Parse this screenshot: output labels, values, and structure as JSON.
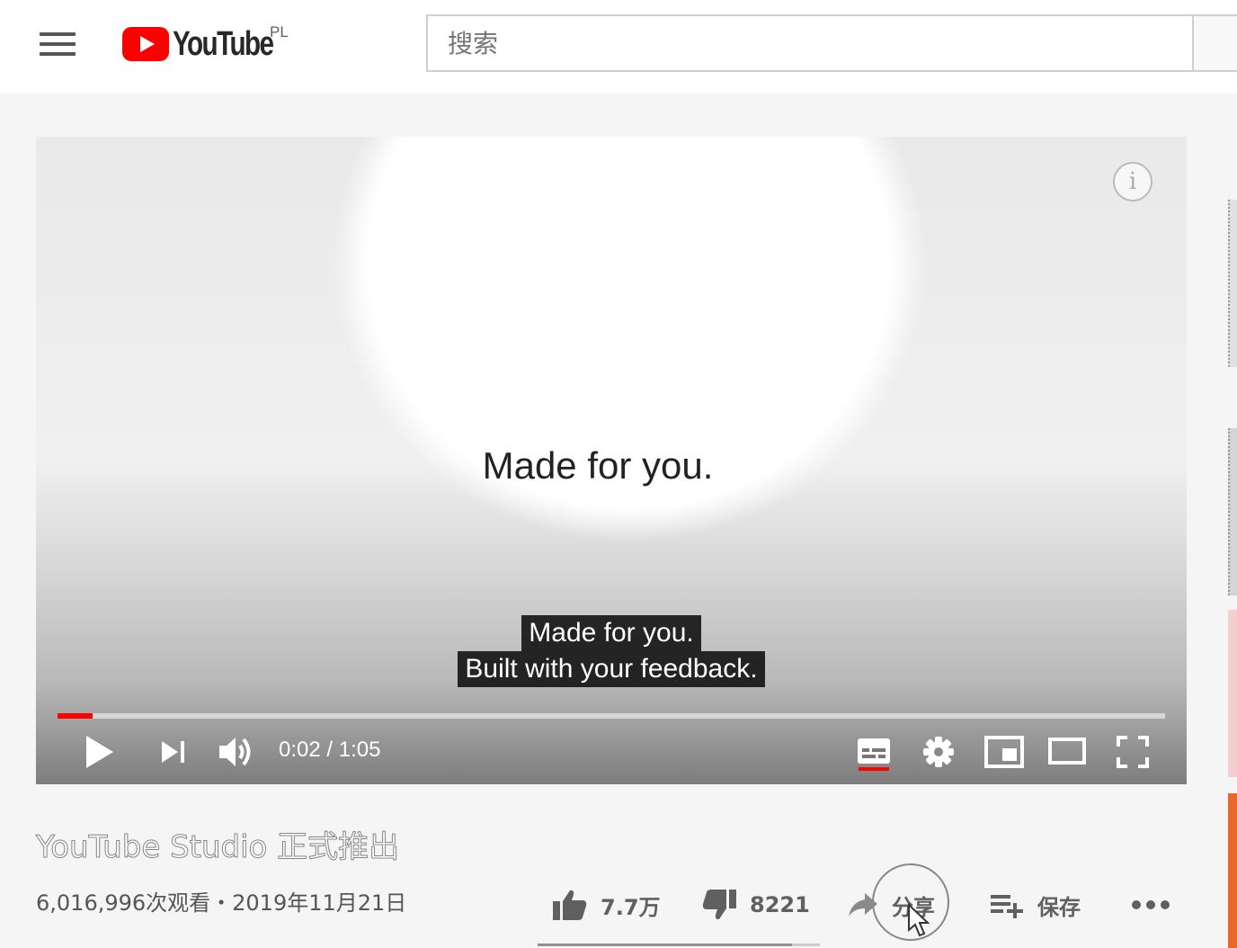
{
  "masthead": {
    "logo_text": "YouTube",
    "region": "PL",
    "search_placeholder": "搜索"
  },
  "player": {
    "headline": "Made for you.",
    "captions": [
      "Made for you.",
      "Built with your feedback."
    ],
    "time": "0:02 / 1:05",
    "progress": 0.032,
    "colors": {
      "accent": "#ff0000"
    }
  },
  "video": {
    "title": "YouTube Studio 正式推出",
    "views_date": "6,016,996次观看・2019年11月21日",
    "likes": "7.7万",
    "dislikes": "8221",
    "share_label": "分享",
    "save_label": "保存",
    "like_fraction": 0.9
  },
  "icons": {
    "menu": "hamburger-menu-icon",
    "play": "play-icon",
    "next": "skip-next-icon",
    "volume": "volume-icon",
    "captions": "subtitles-icon",
    "settings": "gear-icon",
    "miniplayer": "miniplayer-icon",
    "theater": "theater-mode-icon",
    "fullscreen": "fullscreen-icon",
    "like": "thumbs-up-icon",
    "dislike": "thumbs-down-icon",
    "share": "share-arrow-icon",
    "save": "playlist-add-icon",
    "more": "more-horizontal-icon"
  }
}
